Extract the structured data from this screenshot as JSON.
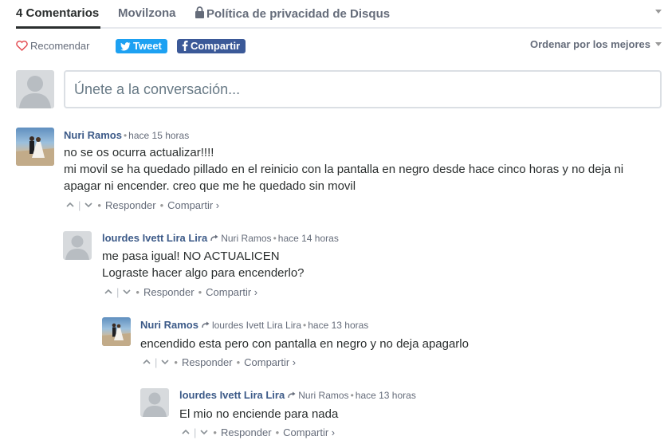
{
  "nav": {
    "comments_tab": "4 Comentarios",
    "site_tab": "Movilzona",
    "privacy_tab": "Política de privacidad de Disqus"
  },
  "actions": {
    "recommend": "Recomendar",
    "tweet": "Tweet",
    "share": "Compartir",
    "sort": "Ordenar por los mejores"
  },
  "composer": {
    "placeholder": "Únete a la conversación..."
  },
  "comments": [
    {
      "author": "Nuri Ramos",
      "reply_to": "",
      "time": "hace 15 horas",
      "lines": [
        "no se os ocurra actualizar!!!!",
        "mi movil se ha quedado pillado en el reinicio con la pantalla en negro desde hace cinco horas y no deja ni",
        "apagar ni encender. creo que me he quedado sin movil"
      ],
      "reply_label": "Responder",
      "share_label": "Compartir ›"
    },
    {
      "author": "lourdes Ivett Lira Lira",
      "reply_to": "Nuri Ramos",
      "time": "hace 14 horas",
      "lines": [
        "me pasa igual! NO ACTUALICEN",
        "Lograste hacer algo para encenderlo?"
      ],
      "reply_label": "Responder",
      "share_label": "Compartir ›"
    },
    {
      "author": "Nuri Ramos",
      "reply_to": "lourdes Ivett Lira Lira",
      "time": "hace 13 horas",
      "lines": [
        "encendido esta pero con pantalla en negro y no deja apagarlo"
      ],
      "reply_label": "Responder",
      "share_label": "Compartir ›"
    },
    {
      "author": "lourdes Ivett Lira Lira",
      "reply_to": "Nuri Ramos",
      "time": "hace 13 horas",
      "lines": [
        "El mio no enciende para nada"
      ],
      "reply_label": "Responder",
      "share_label": "Compartir ›"
    }
  ],
  "colors": {
    "tweet": "#1da1f2",
    "facebook": "#3b5998",
    "author": "#3c5a88"
  }
}
